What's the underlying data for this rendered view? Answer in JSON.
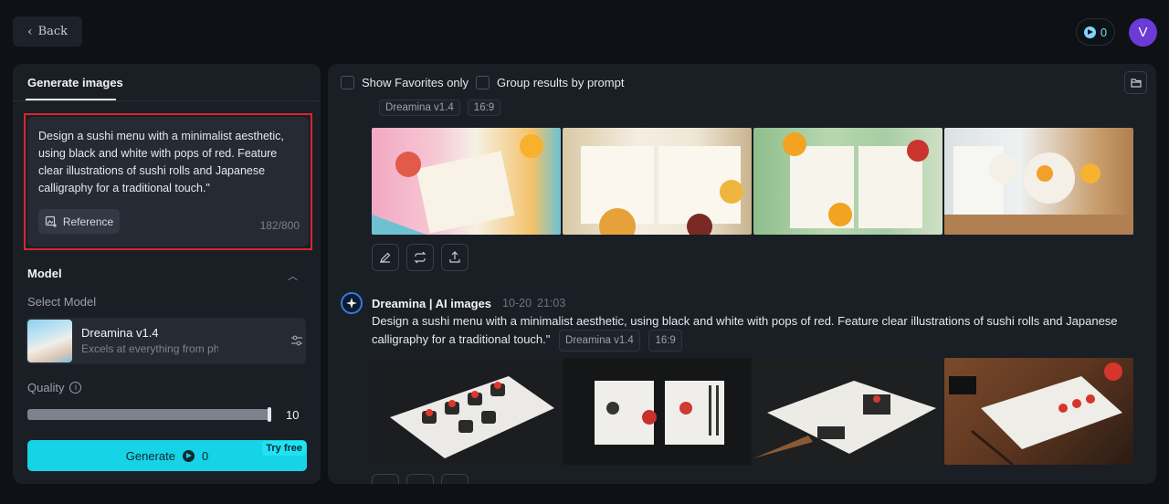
{
  "nav": {
    "back_label": "Back",
    "credits": "0",
    "avatar_initial": "V"
  },
  "left": {
    "tab": "Generate images",
    "prompt": "Design a sushi menu with a minimalist aesthetic, using black and white with pops of red. Feature clear illustrations of sushi rolls and Japanese calligraphy for a traditional touch.\"",
    "reference_label": "Reference",
    "char_count": "182/800",
    "model_heading": "Model",
    "select_model_label": "Select Model",
    "model_name": "Dreamina v1.4",
    "model_desc": "Excels at everything from photorealism to painterly styles",
    "quality_label": "Quality",
    "quality_value": "10",
    "quality_level": 1.0,
    "generate_label": "Generate",
    "generate_cost": "0",
    "try_free": "Try free"
  },
  "right": {
    "show_favorites": "Show Favorites only",
    "group_results": "Group results by prompt",
    "batch1": {
      "model_tag": "Dreamina v1.4",
      "ratio_tag": "16:9"
    },
    "batch2": {
      "author": "Dreamina | AI images",
      "date": "10-20",
      "time": "21:03",
      "prompt": "Design a sushi menu with a minimalist aesthetic, using black and white with pops of red. Feature clear illustrations of sushi rolls and Japanese calligraphy for a traditional touch.\"",
      "model_tag": "Dreamina v1.4",
      "ratio_tag": "16:9"
    }
  },
  "colors": {
    "accent": "#17d3e6",
    "highlight_border": "#d9242e",
    "avatar": "#6c3ad6"
  }
}
